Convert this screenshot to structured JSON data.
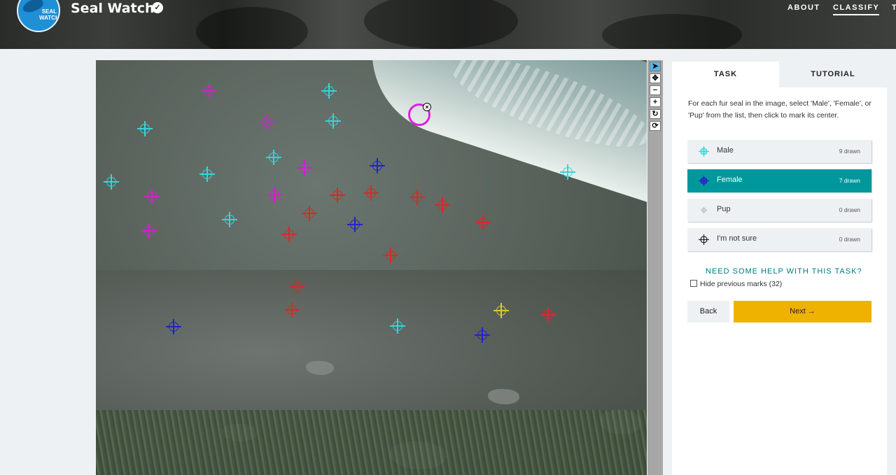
{
  "header": {
    "logo_text": "SEAL\nWATCH",
    "project_title": "Seal Watch",
    "nav": [
      "ABOUT",
      "CLASSIFY",
      "T"
    ]
  },
  "colors": {
    "male": "#2fd8d8",
    "female": "#2323c8",
    "pup": "#bfbfbf",
    "pink": "#d21fd2",
    "red": "#d42a2a",
    "yellow": "#d8d02a",
    "teal": "#00979d",
    "next": "#f0b200"
  },
  "tools": [
    "pointer-icon",
    "move-icon",
    "zoom-out-icon",
    "zoom-in-icon",
    "rotate-icon",
    "reset-icon"
  ],
  "panel": {
    "tabs": [
      "TASK",
      "TUTORIAL"
    ],
    "instructions": "For each fur seal in the image, select 'Male', 'Female', or 'Pup' from the list, then click to mark its center.",
    "choices": [
      {
        "label": "Male",
        "count": "9 drawn"
      },
      {
        "label": "Female",
        "count": "7 drawn"
      },
      {
        "label": "Pup",
        "count": "0 drawn"
      },
      {
        "label": "I'm not sure",
        "count": "0 drawn"
      }
    ],
    "help": "NEED SOME HELP WITH THIS TASK?",
    "hide_marks": "Hide previous marks (32)",
    "back": "Back",
    "next": "Next →"
  }
}
